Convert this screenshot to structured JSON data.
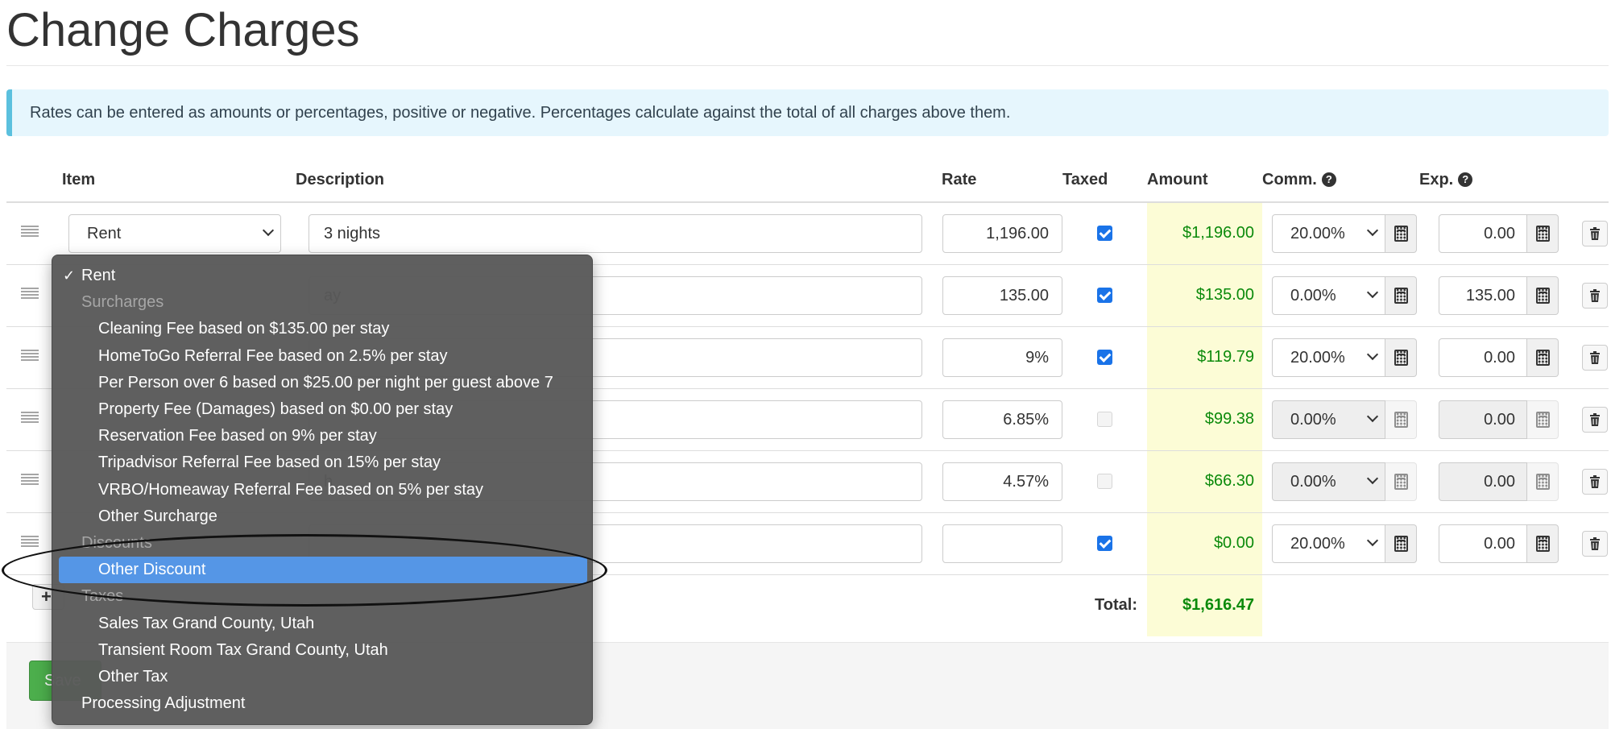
{
  "page": {
    "title": "Change Charges",
    "info": "Rates can be entered as amounts or percentages, positive or negative. Percentages calculate against the total of all charges above them."
  },
  "table": {
    "headers": {
      "item": "Item",
      "description": "Description",
      "rate": "Rate",
      "taxed": "Taxed",
      "amount": "Amount",
      "comm": "Comm.",
      "exp": "Exp."
    },
    "rows": [
      {
        "item": "Rent",
        "description": "3 nights",
        "rate": "1,196.00",
        "taxed": true,
        "amount": "$1,196.00",
        "comm": "20.00%",
        "exp": "0.00",
        "disabled": false
      },
      {
        "item": "",
        "description": "ay",
        "rate": "135.00",
        "taxed": true,
        "amount": "$135.00",
        "comm": "0.00%",
        "exp": "135.00",
        "disabled": false
      },
      {
        "item": "",
        "description": "",
        "rate": "9%",
        "taxed": true,
        "amount": "$119.79",
        "comm": "20.00%",
        "exp": "0.00",
        "disabled": false
      },
      {
        "item": "",
        "description": "",
        "rate": "6.85%",
        "taxed": false,
        "amount": "$99.38",
        "comm": "0.00%",
        "exp": "0.00",
        "disabled": true
      },
      {
        "item": "",
        "description": "h",
        "rate": "4.57%",
        "taxed": false,
        "amount": "$66.30",
        "comm": "0.00%",
        "exp": "0.00",
        "disabled": true
      },
      {
        "item": "",
        "description": "",
        "rate": "",
        "taxed": true,
        "amount": "$0.00",
        "comm": "20.00%",
        "exp": "0.00",
        "disabled": false
      }
    ],
    "total_label": "Total:",
    "total_value": "$1,616.47"
  },
  "buttons": {
    "add": "+",
    "save": "Save"
  },
  "dropdown": {
    "items": [
      {
        "label": "Rent",
        "kind": "top",
        "checked": true
      },
      {
        "label": "Surcharges",
        "kind": "group"
      },
      {
        "label": "Cleaning Fee based on $135.00 per stay",
        "kind": "sub"
      },
      {
        "label": "HomeToGo Referral Fee based on 2.5% per stay",
        "kind": "sub"
      },
      {
        "label": "Per Person over 6 based on $25.00 per night per guest above 7",
        "kind": "sub"
      },
      {
        "label": "Property Fee (Damages) based on $0.00 per stay",
        "kind": "sub"
      },
      {
        "label": "Reservation Fee based on 9% per stay",
        "kind": "sub"
      },
      {
        "label": "Tripadvisor Referral Fee based on 15% per stay",
        "kind": "sub"
      },
      {
        "label": "VRBO/Homeaway Referral Fee based on 5% per stay",
        "kind": "sub"
      },
      {
        "label": "Other Surcharge",
        "kind": "sub"
      },
      {
        "label": "Discounts",
        "kind": "group"
      },
      {
        "label": "Other Discount",
        "kind": "sub",
        "highlighted": true
      },
      {
        "label": "Taxes",
        "kind": "group"
      },
      {
        "label": "Sales Tax Grand County, Utah",
        "kind": "sub"
      },
      {
        "label": "Transient Room Tax Grand County, Utah",
        "kind": "sub"
      },
      {
        "label": "Other Tax",
        "kind": "sub"
      },
      {
        "label": "Processing Adjustment",
        "kind": "top"
      }
    ]
  },
  "colors": {
    "amount_green": "#0b8a0b",
    "amount_bg": "#fcfcd6",
    "highlight_blue": "#5596e6",
    "info_border": "#5bc0de",
    "save_green": "#4cae4c"
  },
  "icons": {
    "drag": "drag-handle-icon",
    "calc": "calculator-icon",
    "trash": "trash-icon",
    "help": "question-circle-icon",
    "check": "checkmark-icon"
  }
}
